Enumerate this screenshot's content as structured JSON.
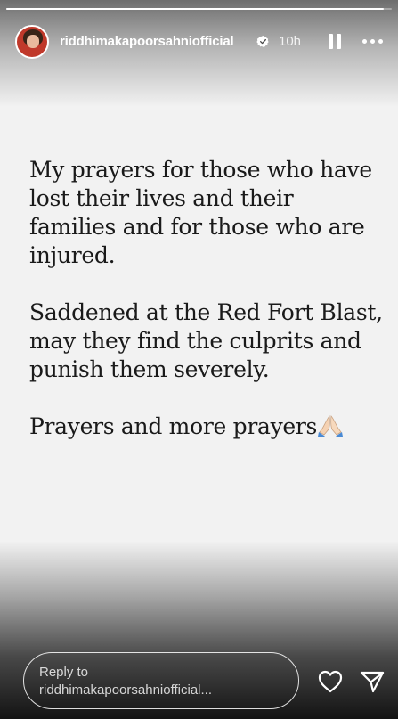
{
  "story": {
    "progress_fraction": 0.98,
    "username": "riddhimakapoorsahniofficial",
    "verified_icon": "verified-badge-icon",
    "time_ago": "10h",
    "pause_icon": "pause-icon",
    "more_icon": "more-options-icon",
    "lines_paragraph_1": "My prayers for those who have lost their lives and their families and for those who are injured.",
    "lines_paragraph_2": "Saddened at the Red Fort Blast, may they find the culprits and punish them severely.",
    "lines_paragraph_3": "Prayers and more prayers",
    "emoji": "folded-hands-emoji"
  },
  "reply": {
    "placeholder_line_1": "Reply to",
    "placeholder_line_2": "riddhimakapoorsahniofficial..."
  },
  "actions": {
    "like_icon": "heart-icon",
    "send_icon": "send-icon"
  },
  "colors": {
    "background": "#f2f2f2",
    "text": "#1a1a1a",
    "overlay_text": "#ffffff",
    "avatar_ring": "#c0392b"
  }
}
